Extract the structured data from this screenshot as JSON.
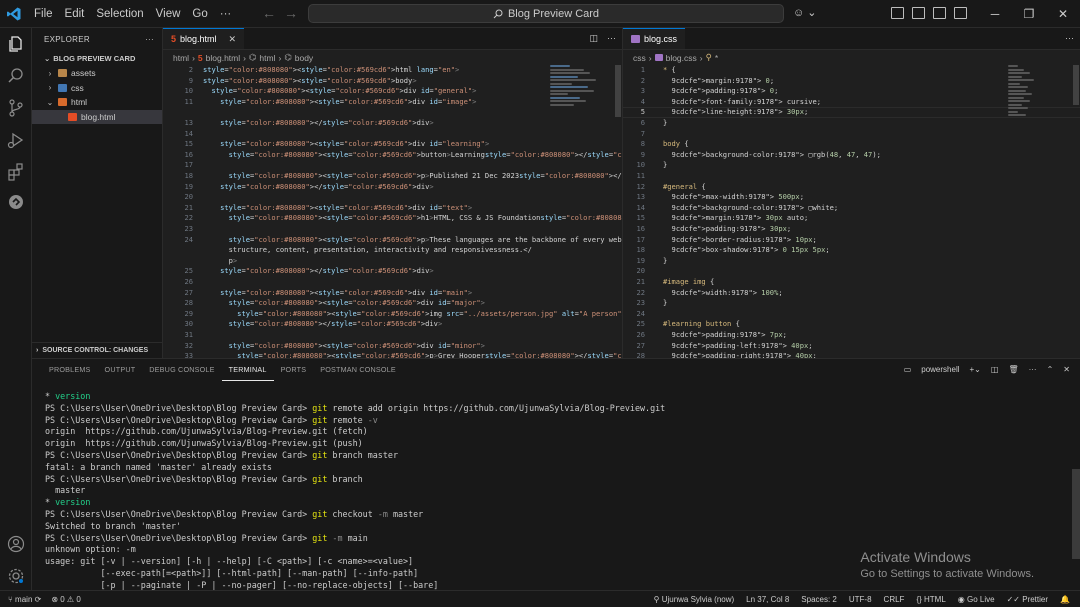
{
  "titlebar": {
    "menu": [
      "File",
      "Edit",
      "Selection",
      "View",
      "Go",
      "···"
    ],
    "search": "Blog Preview Card"
  },
  "explorer": {
    "title": "EXPLORER",
    "folder": "BLOG PREVIEW CARD",
    "items": [
      {
        "label": "assets",
        "type": "folder",
        "open": false,
        "depth": 0,
        "chevron": "›"
      },
      {
        "label": "css",
        "type": "folder",
        "open": false,
        "depth": 0,
        "chevron": "›"
      },
      {
        "label": "html",
        "type": "folder",
        "open": true,
        "depth": 0,
        "chevron": "⌄"
      },
      {
        "label": "blog.html",
        "type": "html-file",
        "depth": 1,
        "chevron": ""
      }
    ],
    "scm": "SOURCE CONTROL: CHANGES"
  },
  "editor1": {
    "tab": "blog.html",
    "breadcrumbs": [
      "html",
      "blog.html",
      "html",
      "body"
    ],
    "lines": [
      {
        "n": "2",
        "t": "<html lang=\"en\">"
      },
      {
        "n": "9",
        "t": "<body>"
      },
      {
        "n": "10",
        "t": "  <div id=\"general\">"
      },
      {
        "n": "11",
        "t": "    <div id=\"image\">"
      },
      {
        "n": "",
        "t": ""
      },
      {
        "n": "13",
        "t": "    </div>"
      },
      {
        "n": "14",
        "t": ""
      },
      {
        "n": "15",
        "t": "    <div id=\"learning\">"
      },
      {
        "n": "16",
        "t": "      <button>Learning</button>"
      },
      {
        "n": "17",
        "t": ""
      },
      {
        "n": "18",
        "t": "      <p>Published 21 Dec 2023</p>"
      },
      {
        "n": "19",
        "t": "    </div>"
      },
      {
        "n": "20",
        "t": ""
      },
      {
        "n": "21",
        "t": "    <div id=\"text\">"
      },
      {
        "n": "22",
        "t": "      <h1>HTML, CSS & JS Foundation</h1>"
      },
      {
        "n": "23",
        "t": ""
      },
      {
        "n": "24",
        "t": "      <p>These languages are the backbone of every website, defining"
      },
      {
        "n": "",
        "t": "      structure, content, presentation, interactivity and responsivessness.</"
      },
      {
        "n": "",
        "t": "      p>"
      },
      {
        "n": "25",
        "t": "    </div>"
      },
      {
        "n": "26",
        "t": ""
      },
      {
        "n": "27",
        "t": "    <div id=\"main\">"
      },
      {
        "n": "28",
        "t": "      <div id=\"major\">"
      },
      {
        "n": "29",
        "t": "        <img src=\"../assets/person.jpg\" alt=\"A person\">"
      },
      {
        "n": "30",
        "t": "      </div>"
      },
      {
        "n": "31",
        "t": ""
      },
      {
        "n": "32",
        "t": "      <div id=\"minor\">"
      },
      {
        "n": "33",
        "t": "        <p>Grey Hooper</p>"
      }
    ]
  },
  "editor2": {
    "tab": "blog.css",
    "breadcrumbs": [
      "css",
      "blog.css",
      "*"
    ],
    "lines": [
      {
        "n": "1",
        "t": "* {"
      },
      {
        "n": "2",
        "t": "  margin: 0;"
      },
      {
        "n": "3",
        "t": "  padding: 0;"
      },
      {
        "n": "4",
        "t": "  font-family: cursive;"
      },
      {
        "n": "5",
        "t": "  line-height: 30px;"
      },
      {
        "n": "6",
        "t": "}"
      },
      {
        "n": "7",
        "t": ""
      },
      {
        "n": "8",
        "t": "body {"
      },
      {
        "n": "9",
        "t": "  background-color: ▢rgb(48, 47, 47);"
      },
      {
        "n": "10",
        "t": "}"
      },
      {
        "n": "11",
        "t": ""
      },
      {
        "n": "12",
        "t": "#general {"
      },
      {
        "n": "13",
        "t": "  max-width: 500px;"
      },
      {
        "n": "14",
        "t": "  background-color: ▢white;"
      },
      {
        "n": "15",
        "t": "  margin: 30px auto;"
      },
      {
        "n": "16",
        "t": "  padding: 30px;"
      },
      {
        "n": "17",
        "t": "  border-radius: 10px;"
      },
      {
        "n": "18",
        "t": "  box-shadow: 0 15px 5px;"
      },
      {
        "n": "19",
        "t": "}"
      },
      {
        "n": "20",
        "t": ""
      },
      {
        "n": "21",
        "t": "#image img {"
      },
      {
        "n": "22",
        "t": "  width: 100%;"
      },
      {
        "n": "23",
        "t": "}"
      },
      {
        "n": "24",
        "t": ""
      },
      {
        "n": "25",
        "t": "#learning button {"
      },
      {
        "n": "26",
        "t": "  padding: 7px;"
      },
      {
        "n": "27",
        "t": "  padding-left: 40px;"
      },
      {
        "n": "28",
        "t": "  padding-right: 40px;"
      }
    ]
  },
  "panel": {
    "tabs": [
      "PROBLEMS",
      "OUTPUT",
      "DEBUG CONSOLE",
      "TERMINAL",
      "PORTS",
      "POSTMAN CONSOLE"
    ],
    "active_tab": "TERMINAL",
    "shell": "powershell",
    "terminal": [
      "* version",
      "PS C:\\Users\\User\\OneDrive\\Desktop\\Blog Preview Card> git remote add origin https://github.com/UjunwaSylvia/Blog-Preview.git",
      "PS C:\\Users\\User\\OneDrive\\Desktop\\Blog Preview Card> git remote -v",
      "origin  https://github.com/UjunwaSylvia/Blog-Preview.git (fetch)",
      "origin  https://github.com/UjunwaSylvia/Blog-Preview.git (push)",
      "PS C:\\Users\\User\\OneDrive\\Desktop\\Blog Preview Card> git branch master",
      "fatal: a branch named 'master' already exists",
      "PS C:\\Users\\User\\OneDrive\\Desktop\\Blog Preview Card> git branch",
      "  master",
      "* version",
      "PS C:\\Users\\User\\OneDrive\\Desktop\\Blog Preview Card> git checkout -m master",
      "Switched to branch 'master'",
      "PS C:\\Users\\User\\OneDrive\\Desktop\\Blog Preview Card> git -m main",
      "unknown option: -m",
      "usage: git [-v | --version] [-h | --help] [-C <path>] [-c <name>=<value>]",
      "           [--exec-path[=<path>]] [--html-path] [--man-path] [--info-path]",
      "           [-p | --paginate | -P | --no-pager] [--no-replace-objects] [--bare]"
    ]
  },
  "watermark": {
    "line1": "Activate Windows",
    "line2": "Go to Settings to activate Windows."
  },
  "statusbar": {
    "branch": "main",
    "problems": "⊗ 0 ⚠ 0",
    "author": "Ujunwa Sylvia (now)",
    "position": "Ln 37, Col 8",
    "spaces": "Spaces: 2",
    "encoding": "UTF-8",
    "eol": "CRLF",
    "language": "HTML",
    "golive": "Go Live",
    "prettier": "Prettier"
  },
  "colors": {
    "accent": "#0078d4",
    "html_icon": "#e44d26",
    "css_icon": "#a074c4",
    "git_command": "#e5e510"
  }
}
